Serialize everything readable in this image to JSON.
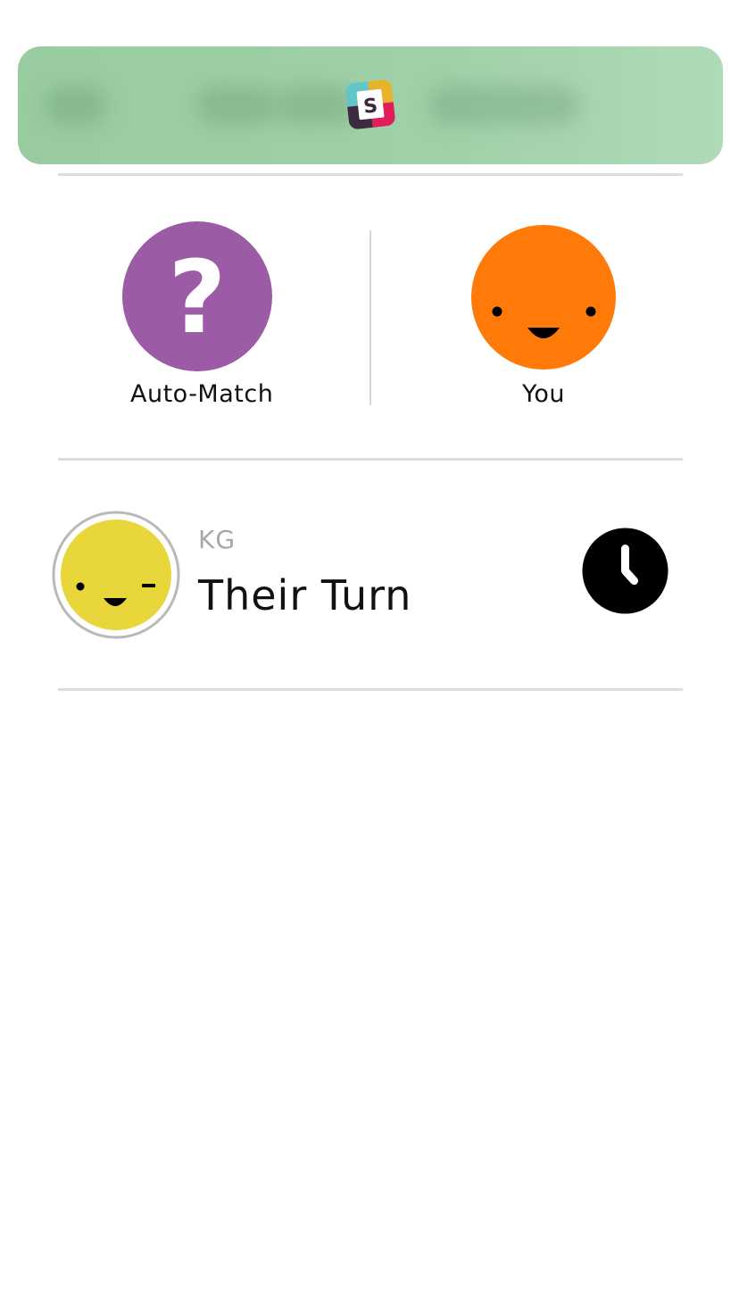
{
  "notification": {
    "app_icon": "slack-icon",
    "app_icon_letter": "S",
    "colors": {
      "banner": "#9fcfa7"
    }
  },
  "players": [
    {
      "label": "Auto-Match",
      "avatar_icon": "question-mark-icon",
      "avatar_glyph": "?",
      "color": "#9b5ba5"
    },
    {
      "label": "You",
      "avatar_icon": "smiley-face-icon",
      "color": "#ff7a08"
    }
  ],
  "games": [
    {
      "opponent": "KG",
      "status": "Their Turn",
      "avatar_icon": "winking-face-icon",
      "avatar_color": "#e8d63a",
      "status_icon": "clock-icon"
    }
  ]
}
